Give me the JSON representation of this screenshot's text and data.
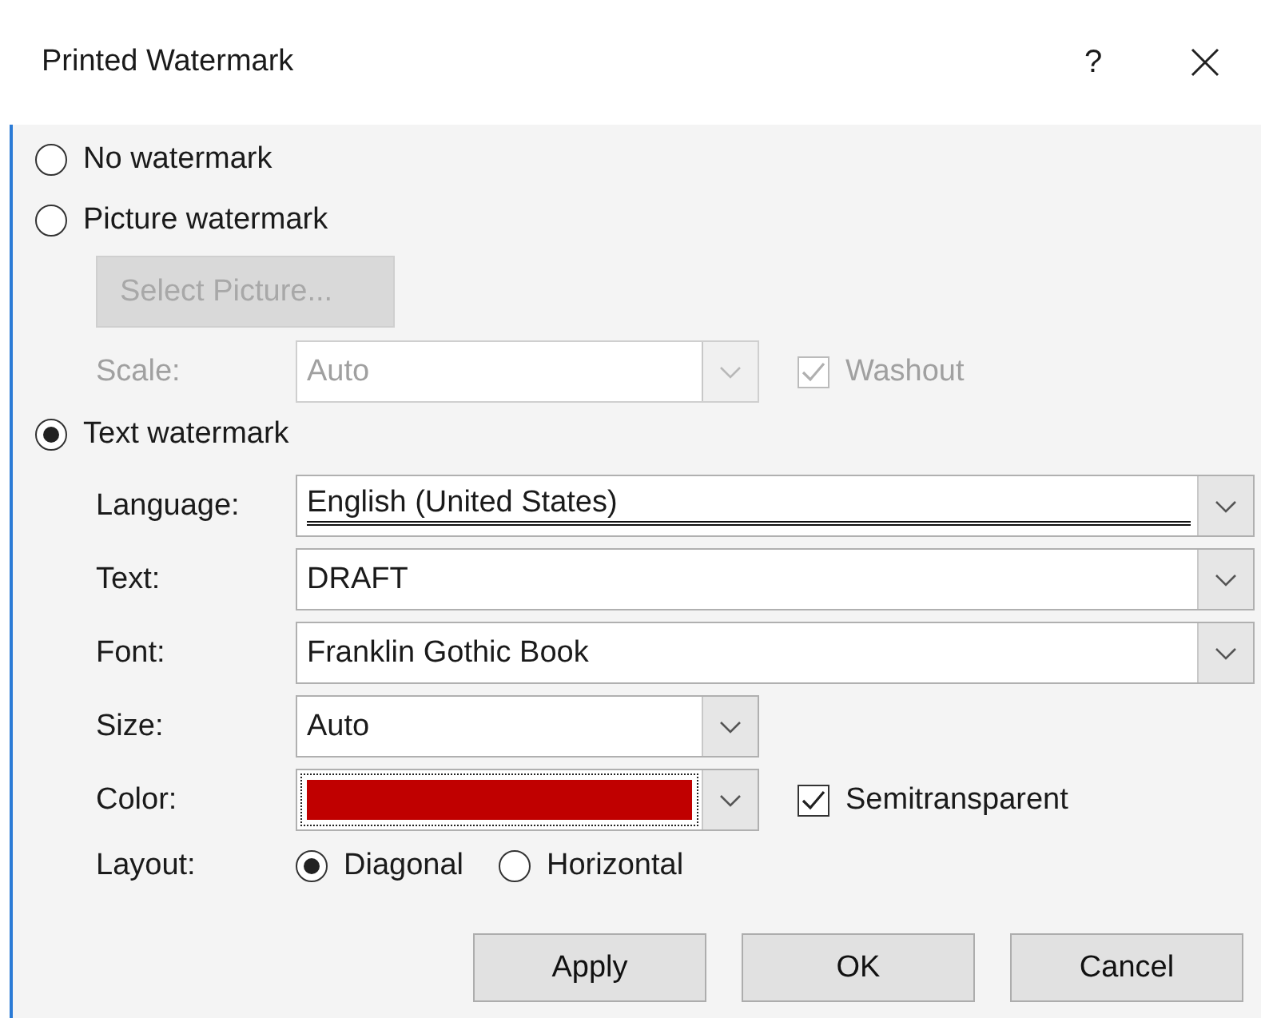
{
  "window": {
    "title": "Printed Watermark",
    "help_button": "?"
  },
  "watermark_type": [
    {
      "label": "No watermark",
      "selected": false
    },
    {
      "label": "Picture watermark",
      "selected": false
    },
    {
      "label": "Text watermark",
      "selected": true
    }
  ],
  "picture_options": {
    "disabled": true,
    "select_button": "Select Picture...",
    "scale": {
      "label": "Scale:",
      "value": "Auto"
    },
    "washout": {
      "label": "Washout",
      "checked": true
    }
  },
  "text_options": {
    "language": {
      "label": "Language:",
      "value": "English (United States)"
    },
    "text": {
      "label": "Text:",
      "value": "DRAFT"
    },
    "font": {
      "label": "Font:",
      "value": "Franklin Gothic Book"
    },
    "size": {
      "label": "Size:",
      "value": "Auto"
    },
    "color": {
      "label": "Color:",
      "color": "#c00000"
    },
    "semitransparent": {
      "label": "Semitransparent",
      "checked": true
    },
    "layout": {
      "label": "Layout:",
      "options": [
        {
          "label": "Diagonal",
          "selected": true
        },
        {
          "label": "Horizontal",
          "selected": false
        }
      ]
    }
  },
  "buttons": [
    {
      "label": "Apply"
    },
    {
      "label": "OK"
    },
    {
      "label": "Cancel"
    }
  ]
}
